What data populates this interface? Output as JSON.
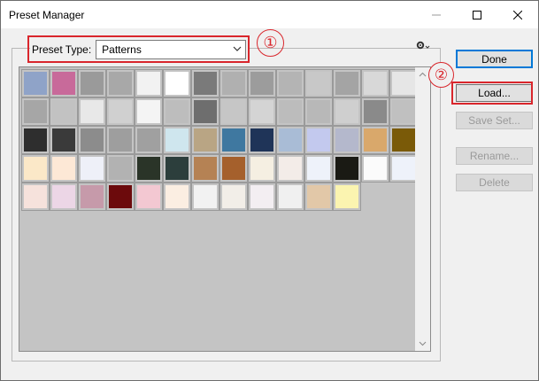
{
  "window": {
    "title": "Preset Manager"
  },
  "preset_type": {
    "label": "Preset Type:",
    "selected": "Patterns"
  },
  "buttons": {
    "done": "Done",
    "load": "Load...",
    "save_set": "Save Set...",
    "rename": "Rename...",
    "delete": "Delete"
  },
  "callouts": {
    "one": "①",
    "two": "②"
  },
  "colors": {
    "highlight": "#d9262c",
    "focus": "#0078d7",
    "panel_bg": "#c4c4c4"
  },
  "swatches": [
    "#8fa3c8",
    "#c86a9a",
    "#9a9a9a",
    "#a8a8a8",
    "#f2f2f2",
    "#ffffff",
    "#7a7a7a",
    "#b0b0b0",
    "#9c9c9c",
    "#b4b4b4",
    "#c8c8c8",
    "#a4a4a4",
    "#d8d8d8",
    "#e6e6e6",
    "#a6a6a6",
    "#c2c2c2",
    "#e8e8e8",
    "#d0d0d0",
    "#f4f4f4",
    "#bdbdbd",
    "#6e6e6e",
    "#c6c6c6",
    "#d4d4d4",
    "#bcbcbc",
    "#b8b8b8",
    "#cfcfcf",
    "#8a8a8a",
    "#c0c0c0",
    "#2e2e2e",
    "#3a3a3a",
    "#8c8c8c",
    "#9e9e9e",
    "#a0a0a0",
    "#cfe6ee",
    "#b9a584",
    "#3f78a0",
    "#1f3458",
    "#a9bcd6",
    "#c3c9ee",
    "#b4b8cc",
    "#d9a86b",
    "#7a5a08",
    "#fbe8c8",
    "#fde8d6",
    "#eef0f8",
    "#b2b2b2",
    "#2a3428",
    "#2c3e3c",
    "#b58254",
    "#a5602c",
    "#f5efe2",
    "#f3ece8",
    "#eef2fa",
    "#1a1a14",
    "#fbfbfb",
    "#eef2fa",
    "#f6e2dc",
    "#ecd6e6",
    "#c69aaa",
    "#6c0a0c",
    "#f3c8d2",
    "#fbeee2",
    "#f2f2f2",
    "#f2eee8",
    "#f3eef2",
    "#f0f0f0",
    "#e2c8a8",
    "#fbf4b0"
  ]
}
